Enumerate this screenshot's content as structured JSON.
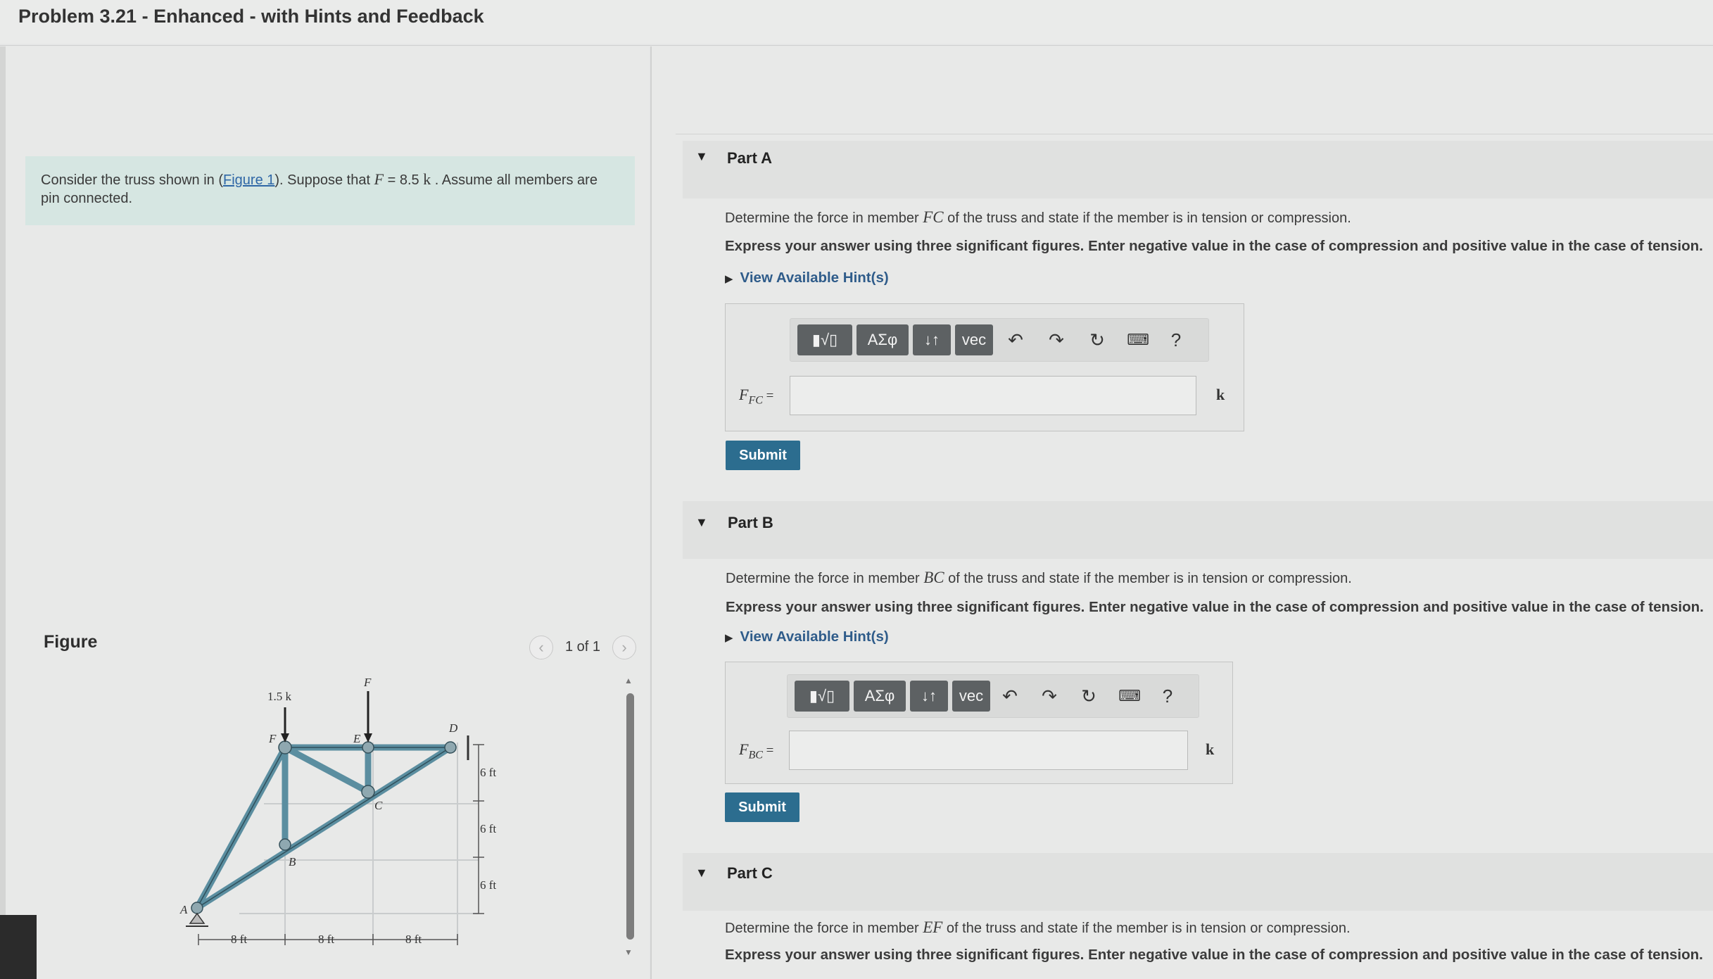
{
  "title": "Problem 3.21 - Enhanced - with Hints and Feedback",
  "problem": {
    "intro": "Consider the truss shown in (",
    "figure_link": "Figure 1",
    "mid": "). Suppose that ",
    "var_f": "F",
    "eq": " = 8.5 ",
    "unit": "k",
    "rest": " . Assume all members are",
    "line2": "pin connected."
  },
  "figure": {
    "label": "Figure",
    "pager": "1 of 1",
    "prev_icon": "chevron-left-icon",
    "next_icon": "chevron-right-icon",
    "truss_labels": {
      "load1": "1.5 k",
      "load2": "F",
      "nodeF": "F",
      "nodeE": "E",
      "nodeD": "D",
      "nodeC": "C",
      "nodeB": "B",
      "nodeA": "A",
      "dimH": "6 ft",
      "dimW": "8 ft"
    }
  },
  "toolbar": {
    "templates": "▮√▯",
    "greek": "ΑΣφ",
    "arrows": "↓↑",
    "vec": "vec",
    "undo_icon": "undo-icon",
    "redo_icon": "redo-icon",
    "reset_icon": "reset-icon",
    "keyboard_icon": "keyboard-icon",
    "help": "?"
  },
  "parts": [
    {
      "title": "Part A",
      "question_pre": "Determine the force in member ",
      "member": "FC",
      "question_post": " of the truss and state if the member is in tension or compression.",
      "instruction": "Express your answer using three significant figures. Enter negative value in the case of compression and positive value in the case of tension.",
      "hint": "View Available Hint(s)",
      "var": "F",
      "var_sub": "FC",
      "eq": " =",
      "unit": "k",
      "input_value": "",
      "submit": "Submit"
    },
    {
      "title": "Part B",
      "question_pre": "Determine the force in member ",
      "member": "BC",
      "question_post": " of the truss and state if the member is in tension or compression.",
      "instruction": "Express your answer using three significant figures. Enter negative value in the case of compression and positive value in the case of tension.",
      "hint": "View Available Hint(s)",
      "var": "F",
      "var_sub": "BC",
      "eq": " =",
      "unit": "k",
      "input_value": "",
      "submit": "Submit"
    },
    {
      "title": "Part C",
      "question_pre": "Determine the force in member ",
      "member": "EF",
      "question_post": " of the truss and state if the member is in tension or compression.",
      "instruction": "Express your answer using three significant figures. Enter negative value in the case of compression and positive value in the case of tension."
    }
  ]
}
